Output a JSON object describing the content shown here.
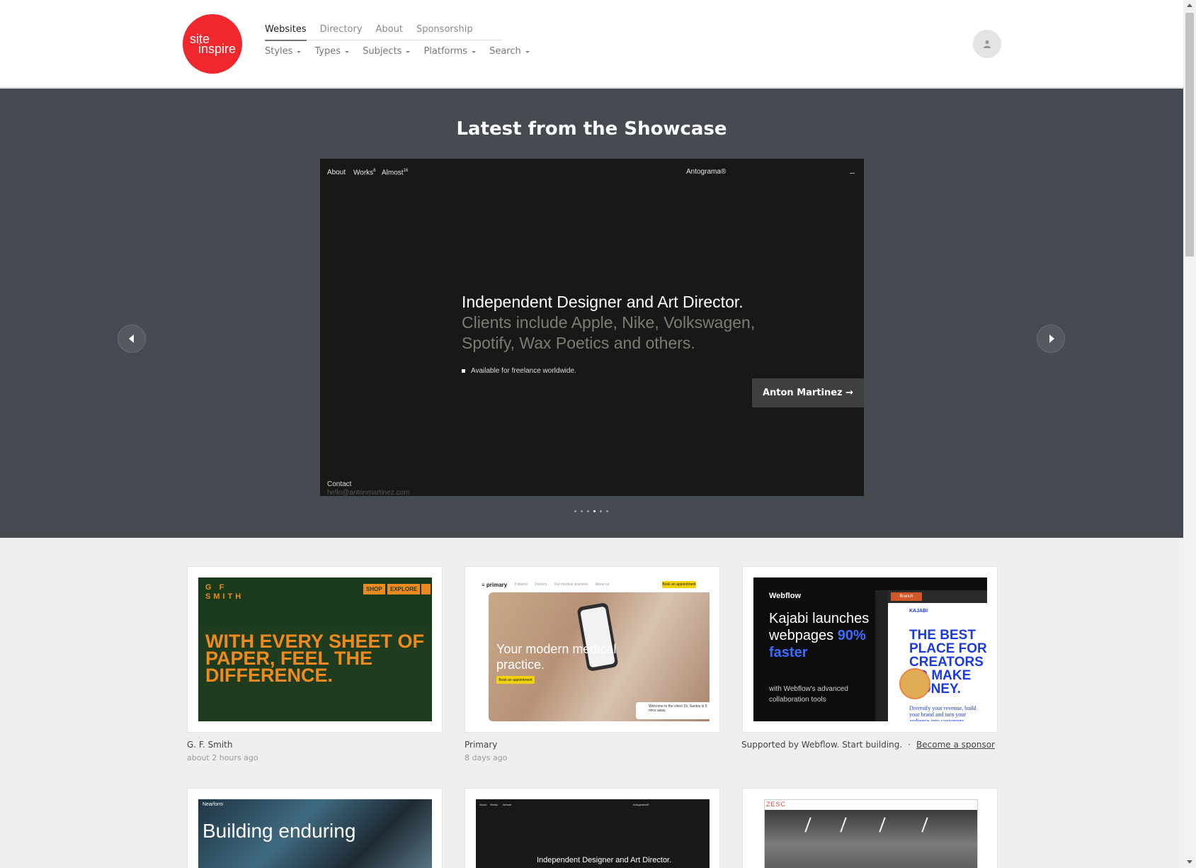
{
  "nav": {
    "logo_line1": "site",
    "logo_line2": "inspire",
    "top": [
      "Websites",
      "Directory",
      "About",
      "Sponsorship"
    ],
    "sub": [
      "Styles",
      "Types",
      "Subjects",
      "Platforms",
      "Search"
    ]
  },
  "hero": {
    "title": "Latest from the Showcase",
    "slide": {
      "nav_about": "About",
      "nav_works": "Works",
      "nav_works_sup": "8",
      "nav_almost": "Almost",
      "nav_almost_sup": "16",
      "brand": "Antograma®",
      "headline": "Independent Designer and Art Director.",
      "subline": "Clients include Apple, Nike, Volkswagen, Spotify, Wax Poetics and others.",
      "bullet": "Available for freelance worldwide.",
      "contact": "Contact",
      "email": "hello@antonmartinez.com"
    },
    "cta": "Anton Martinez →",
    "dots_total": 6,
    "dots_active": 4
  },
  "cards": {
    "gfsmith": {
      "title": "G. F. Smith",
      "time": "about 2 hours ago",
      "logo": "G F SMITH",
      "shop": "SHOP",
      "explore": "EXPLORE",
      "headline": "WITH EVERY SHEET OF PAPER, FEEL THE DIFFERENCE."
    },
    "primary": {
      "title": "Primary",
      "time": "8 days ago",
      "logo": "≡ primary",
      "navs": [
        "Patients",
        "Doctors",
        "Our medical practices",
        "About us"
      ],
      "cta": "Book an appointment",
      "headline": "Your modern medical practice.",
      "button": "Book an appointment",
      "toast": "Welcome to the clinic! Dr. Santos is 5 mins away."
    },
    "webflow": {
      "logo": "Webflow",
      "headline_1": "Kajabi launches webpages",
      "headline_2": "90% faster",
      "sub": "with Webflow's advanced collaboration tools",
      "branch": "Branch",
      "kajabi": "KAJABI",
      "kajabi_head": "THE BEST PLACE FOR CREATORS TO MAKE MONEY.",
      "kajabi_sub": "Diversify your revenue, build your brand and turn your audience into customers."
    },
    "sponsor": {
      "text": "Supported by Webflow. Start building.",
      "sep": "·",
      "link": "Become a sponsor"
    },
    "row2": {
      "nearform_logo": "Nearform",
      "nearform_head": "Building enduring",
      "anton_text": "Independent Designer and Art Director.",
      "anton_nav": [
        "About",
        "Works",
        "Almost",
        "Antograma®"
      ],
      "zesc_logo": "ZESC"
    }
  }
}
